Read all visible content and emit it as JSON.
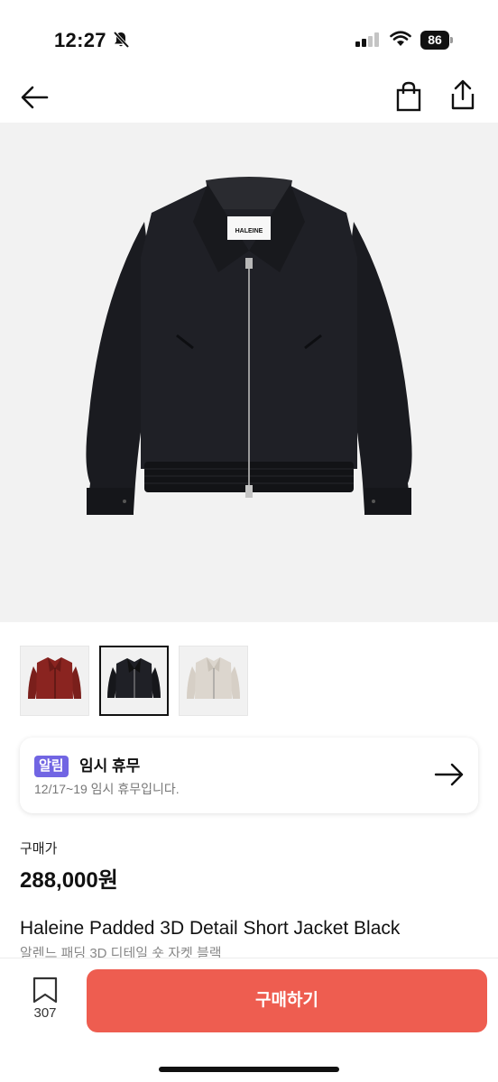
{
  "status_bar": {
    "time": "12:27",
    "battery": "86"
  },
  "product": {
    "brand_label": "HALEINE",
    "thumbnail_colors": [
      "#7a1f1b",
      "#16171b",
      "#d9d3cb"
    ],
    "selected_thumbnail": 2
  },
  "notice": {
    "badge": "알림",
    "title": "임시 휴무",
    "subtitle": "12/17~19 임시 휴무입니다."
  },
  "price": {
    "label": "구매가",
    "value": "288,000원"
  },
  "title": {
    "name": "Haleine Padded 3D Detail Short Jacket Black",
    "korean_name": "알렌느 패딩 3D 디테일 숏 자켓 블랙"
  },
  "bottom": {
    "like_count": "307",
    "buy_label": "구매하기"
  },
  "colors": {
    "accent": "#ee5d50",
    "badge": "#7165e3"
  }
}
